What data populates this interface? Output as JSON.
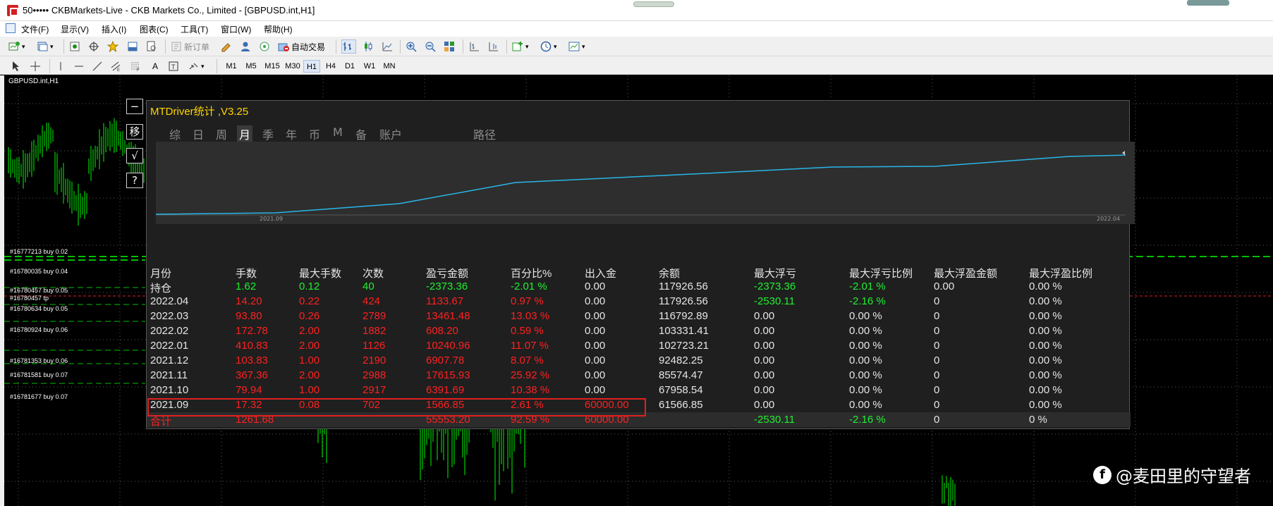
{
  "window": {
    "title": "50••••• CKBMarkets-Live - CKB Markets Co., Limited - [GBPUSD.int,H1]"
  },
  "menu": [
    "文件(F)",
    "显示(V)",
    "插入(I)",
    "图表(C)",
    "工具(T)",
    "窗口(W)",
    "帮助(H)"
  ],
  "toolbar": {
    "new_order_label": "新订单",
    "auto_trade_label": "自动交易",
    "timeframes": [
      "M1",
      "M5",
      "M15",
      "M30",
      "H1",
      "H4",
      "D1",
      "W1",
      "MN"
    ],
    "active_timeframe": "H1"
  },
  "chart": {
    "symbol_label": "GBPUSD.int,H1",
    "order_labels": [
      "#16777213 buy 0.02",
      "#16780035 buy 0.04",
      "#16780457 buy 0.05",
      "#16780634 buy 0.05",
      "#16780924 buy 0.06",
      "#16781353 buy 0.06",
      "#16781581 buy 0.07",
      "#16781677 buy 0.07"
    ],
    "order_label_tp": "#16780457 tp",
    "side_buttons": [
      "−",
      "移",
      "√",
      "?"
    ]
  },
  "panel": {
    "title": "MTDriver统计 ,V3.25",
    "tabs": [
      "综",
      "日",
      "周",
      "月",
      "季",
      "年",
      "币",
      "M",
      "备",
      "账户",
      "路径"
    ],
    "active_tab": "月",
    "equity_chart": {
      "x_start_label": "2021.09",
      "x_end_label": "2022.04",
      "line_color": "#29b6e8"
    },
    "columns": [
      "月份",
      "手数",
      "最大手数",
      "次数",
      "盈亏金额",
      "百分比%",
      "出入金",
      "余额",
      "最大浮亏",
      "最大浮亏比例",
      "最大浮盈金额",
      "最大浮盈比例"
    ],
    "rows": [
      {
        "month": "持仓",
        "lots": "1.62",
        "max_lots": "0.12",
        "count": "40",
        "pnl": "-2373.36",
        "pct": "-2.01 %",
        "flow": "0.00",
        "balance": "117926.56",
        "max_dd": "-2373.36",
        "max_dd_pct": "-2.01 %",
        "max_fp": "0.00",
        "max_fp_pct": "0.00 %",
        "color": "green"
      },
      {
        "month": "2022.04",
        "lots": "14.20",
        "max_lots": "0.22",
        "count": "424",
        "pnl": "1133.67",
        "pct": "0.97 %",
        "flow": "0.00",
        "balance": "117926.56",
        "max_dd": "-2530.11",
        "max_dd_pct": "-2.16 %",
        "max_fp": "0",
        "max_fp_pct": "0.00 %",
        "color": "red"
      },
      {
        "month": "2022.03",
        "lots": "93.80",
        "max_lots": "0.26",
        "count": "2789",
        "pnl": "13461.48",
        "pct": "13.03 %",
        "flow": "0.00",
        "balance": "116792.89",
        "max_dd": "0.00",
        "max_dd_pct": "0.00 %",
        "max_fp": "0",
        "max_fp_pct": "0.00 %",
        "color": "red"
      },
      {
        "month": "2022.02",
        "lots": "172.78",
        "max_lots": "2.00",
        "count": "1882",
        "pnl": "608.20",
        "pct": "0.59 %",
        "flow": "0.00",
        "balance": "103331.41",
        "max_dd": "0.00",
        "max_dd_pct": "0.00 %",
        "max_fp": "0",
        "max_fp_pct": "0.00 %",
        "color": "red"
      },
      {
        "month": "2022.01",
        "lots": "410.83",
        "max_lots": "2.00",
        "count": "1126",
        "pnl": "10240.96",
        "pct": "11.07 %",
        "flow": "0.00",
        "balance": "102723.21",
        "max_dd": "0.00",
        "max_dd_pct": "0.00 %",
        "max_fp": "0",
        "max_fp_pct": "0.00 %",
        "color": "red"
      },
      {
        "month": "2021.12",
        "lots": "103.83",
        "max_lots": "1.00",
        "count": "2190",
        "pnl": "6907.78",
        "pct": "8.07 %",
        "flow": "0.00",
        "balance": "92482.25",
        "max_dd": "0.00",
        "max_dd_pct": "0.00 %",
        "max_fp": "0",
        "max_fp_pct": "0.00 %",
        "color": "red"
      },
      {
        "month": "2021.11",
        "lots": "367.36",
        "max_lots": "2.00",
        "count": "2988",
        "pnl": "17615.93",
        "pct": "25.92 %",
        "flow": "0.00",
        "balance": "85574.47",
        "max_dd": "0.00",
        "max_dd_pct": "0.00 %",
        "max_fp": "0",
        "max_fp_pct": "0.00 %",
        "color": "red"
      },
      {
        "month": "2021.10",
        "lots": "79.94",
        "max_lots": "1.00",
        "count": "2917",
        "pnl": "6391.69",
        "pct": "10.38 %",
        "flow": "0.00",
        "balance": "67958.54",
        "max_dd": "0.00",
        "max_dd_pct": "0.00 %",
        "max_fp": "0",
        "max_fp_pct": "0.00 %",
        "color": "red"
      },
      {
        "month": "2021.09",
        "lots": "17.32",
        "max_lots": "0.08",
        "count": "702",
        "pnl": "1566.85",
        "pct": "2.61 %",
        "flow": "60000.00",
        "balance": "61566.85",
        "max_dd": "0.00",
        "max_dd_pct": "0.00 %",
        "max_fp": "0",
        "max_fp_pct": "0.00 %",
        "color": "red"
      }
    ],
    "total": {
      "month": "合计",
      "lots": "1261.68",
      "pnl": "55553.20",
      "pct": "92.59 %",
      "flow": "60000.00",
      "max_dd": "-2530.11",
      "max_dd_pct": "-2.16 %",
      "max_fp": "0",
      "max_fp_pct": "0 %"
    }
  },
  "watermark": {
    "text": "@麦田里的守望者"
  }
}
